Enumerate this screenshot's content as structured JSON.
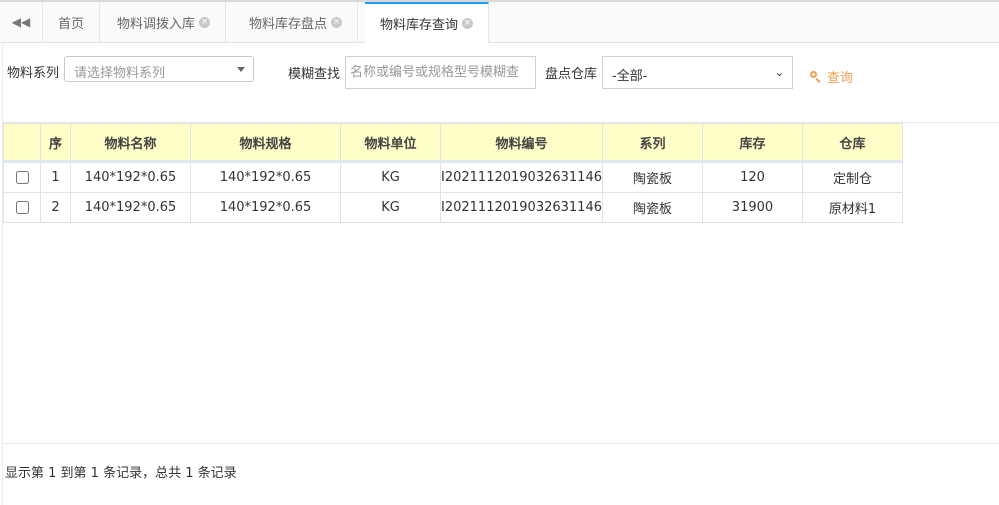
{
  "tabs": [
    {
      "label": "首页",
      "closable": false
    },
    {
      "label": "物料调拨入库",
      "closable": true
    },
    {
      "label": "物料库存盘点",
      "closable": true
    },
    {
      "label": "物料库存查询",
      "closable": true,
      "active": true
    }
  ],
  "toolbar": {
    "series_label": "物料系列",
    "series_placeholder": "请选择物料系列",
    "search_label": "模糊查找",
    "search_placeholder": "名称或编号或规格型号模糊查",
    "warehouse_label": "盘点仓库",
    "warehouse_value": "-全部-",
    "query_label": "查询"
  },
  "table": {
    "columns": [
      "",
      "序",
      "物料名称",
      "物料规格",
      "物料单位",
      "物料编号",
      "系列",
      "库存",
      "仓库"
    ],
    "rows": [
      {
        "seq": "1",
        "name": "140*192*0.65",
        "spec": "140*192*0.65",
        "unit": "KG",
        "code": "I2021112019032631146",
        "series": "陶瓷板",
        "stock": "120",
        "warehouse": "定制仓"
      },
      {
        "seq": "2",
        "name": "140*192*0.65",
        "spec": "140*192*0.65",
        "unit": "KG",
        "code": "I2021112019032631146",
        "series": "陶瓷板",
        "stock": "31900",
        "warehouse": "原材料1"
      }
    ]
  },
  "pagination": {
    "info": "显示第 1 到第 1 条记录，总共 1 条记录"
  },
  "colors": {
    "header_bg": "#fffdc8",
    "query_accent": "#f0a050",
    "active_tab_accent": "#1e9fff"
  }
}
